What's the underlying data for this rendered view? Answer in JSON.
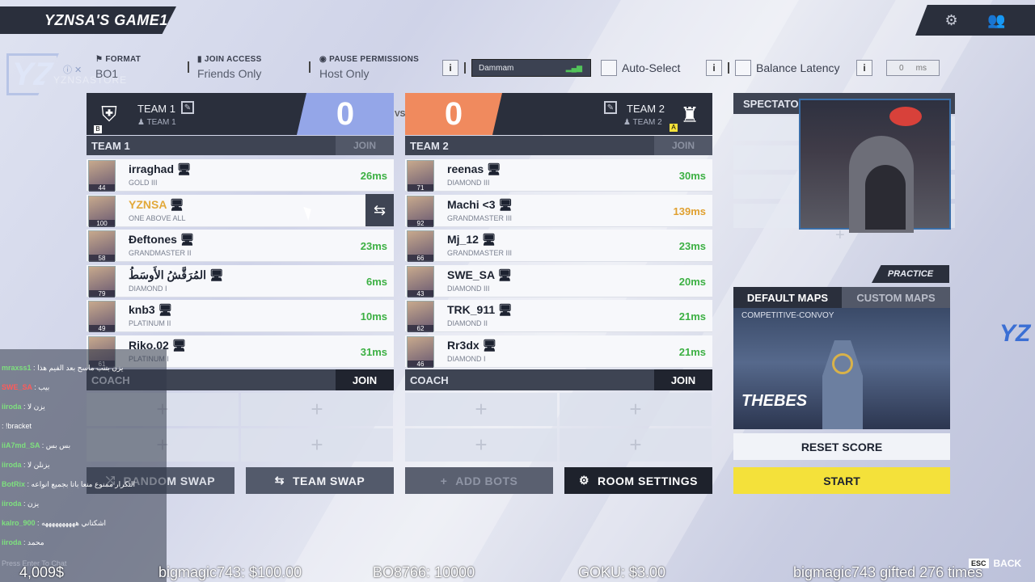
{
  "header": {
    "title": "YZNSA'S GAME1",
    "settings_icon": "gear-icon",
    "friends_icon": "friends-icon"
  },
  "brand": {
    "logo_letter": "YZ",
    "logo_text": "YZNSASTORE",
    "social": "ⓘ ✕"
  },
  "settings": {
    "format_label": "FORMAT",
    "format_value": "BO1",
    "join_label": "JOIN ACCESS",
    "join_value": "Friends Only",
    "pause_label": "PAUSE PERMISSIONS",
    "pause_value": "Host Only",
    "region": "Dammam",
    "auto_select": "Auto-Select",
    "balance_latency": "Balance Latency",
    "latency_value": "0",
    "latency_unit": "ms",
    "info": "i"
  },
  "team1": {
    "name": "TEAM 1",
    "sub": "TEAM 1",
    "badge_letter": "B",
    "score": "0",
    "list_label": "TEAM 1",
    "join_label": "JOIN",
    "players": [
      {
        "name": "irraghad",
        "rank": "GOLD III",
        "level": "44",
        "ping": "26ms",
        "ping_color": "#3cb043"
      },
      {
        "name": "YZNSA",
        "rank": "ONE ABOVE ALL",
        "level": "100",
        "ping": "",
        "ping_color": "#3cb043",
        "highlight": "#e2a93a"
      },
      {
        "name": "Ðeftones",
        "rank": "GRANDMASTER II",
        "level": "58",
        "ping": "23ms",
        "ping_color": "#3cb043"
      },
      {
        "name": "المُرَقَّشُ الأَوسَطُ",
        "rank": "DIAMOND I",
        "level": "79",
        "ping": "6ms",
        "ping_color": "#3cb043"
      },
      {
        "name": "knb3",
        "rank": "PLATINUM II",
        "level": "49",
        "ping": "10ms",
        "ping_color": "#3cb043"
      },
      {
        "name": "Riko.02",
        "rank": "PLATINUM I",
        "level": "61",
        "ping": "31ms",
        "ping_color": "#3cb043"
      }
    ]
  },
  "team2": {
    "name": "TEAM 2",
    "sub": "TEAM 2",
    "badge_letter": "A",
    "score": "0",
    "list_label": "TEAM 2",
    "join_label": "JOIN",
    "players": [
      {
        "name": "reenas",
        "rank": "DIAMOND III",
        "level": "71",
        "ping": "30ms",
        "ping_color": "#3cb043"
      },
      {
        "name": "Machi <3",
        "rank": "GRANDMASTER III",
        "level": "92",
        "ping": "139ms",
        "ping_color": "#e0a030"
      },
      {
        "name": "Mj_12",
        "rank": "GRANDMASTER III",
        "level": "66",
        "ping": "23ms",
        "ping_color": "#3cb043"
      },
      {
        "name": "SWE_SA",
        "rank": "DIAMOND III",
        "level": "43",
        "ping": "20ms",
        "ping_color": "#3cb043"
      },
      {
        "name": "TRK_911",
        "rank": "DIAMOND II",
        "level": "62",
        "ping": "21ms",
        "ping_color": "#3cb043"
      },
      {
        "name": "Rr3dx",
        "rank": "DIAMOND I",
        "level": "46",
        "ping": "21ms",
        "ping_color": "#3cb043"
      }
    ]
  },
  "vs": "VS",
  "coach": {
    "label": "COACH",
    "join": "JOIN",
    "plus": "+"
  },
  "buttons": {
    "random_swap": "RANDOM SWAP",
    "team_swap": "TEAM SWAP",
    "add_bots": "ADD BOTS",
    "room_settings": "ROOM SETTINGS",
    "reset_score": "RESET SCORE",
    "start": "START"
  },
  "spectators": {
    "label": "SPECTATORS",
    "plus": "+"
  },
  "practice": "PRACTICE",
  "maps": {
    "default_tab": "DEFAULT MAPS",
    "custom_tab": "CUSTOM MAPS",
    "category": "COMPETITIVE-CONVOY",
    "name": "THEBES"
  },
  "chat": [
    {
      "user": "mraxss1",
      "msg": ": يزن بتنب ماسح بعد الفيم هذا",
      "color": "#7ee07e"
    },
    {
      "user": "SWE_SA",
      "msg": ": بيب",
      "color": "#ff5a5a"
    },
    {
      "user": "iiroda",
      "msg": ": يزن لا",
      "color": "#7ee07e"
    },
    {
      "user": "",
      "msg": ": !bracket",
      "color": "#ff5a5a"
    },
    {
      "user": "iiA7md_SA",
      "msg": ": بس بس",
      "color": "#7ee07e"
    },
    {
      "user": "iiroda",
      "msg": ": يزنلن لا",
      "color": "#7ee07e"
    },
    {
      "user": "BotRix",
      "msg": ": التكرار ممنوع منعا باتا بجميع انواعه",
      "color": "#7ee07e"
    },
    {
      "user": "iiroda",
      "msg": ": يزن",
      "color": "#7ee07e"
    },
    {
      "user": "kalro_900",
      "msg": ": اشكتاني ههههههههههه",
      "color": "#7ee07e"
    },
    {
      "user": "iiroda",
      "msg": ": محمد",
      "color": "#7ee07e"
    }
  ],
  "chat_placeholder": "Press Enter To Chat",
  "ticker": {
    "item1": "bigmagic743: $100.00",
    "item2": "BO8766: 10000",
    "item3": "GOKU: $3.00",
    "item4": "bigmagic743 gifted 276 times",
    "item0": "4,009$"
  },
  "esc": {
    "key": "ESC",
    "label": "BACK"
  }
}
